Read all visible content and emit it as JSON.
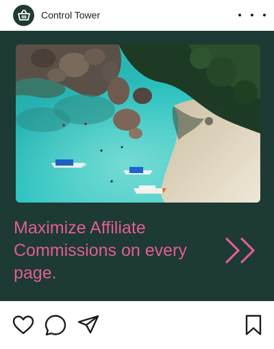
{
  "header": {
    "account_name": "Control Tower",
    "avatar_icon": "shopping-basket-icon",
    "more_icon": "more-horizontal-icon"
  },
  "post": {
    "image_alt": "Aerial view of turquoise water, boats and a sandy beach",
    "headline": "Maximize Affiliate Commissions on every page.",
    "cta_icon": "double-chevron-right-icon"
  },
  "actions": {
    "like_icon": "heart-icon",
    "comment_icon": "comment-icon",
    "share_icon": "send-icon",
    "save_icon": "bookmark-icon"
  },
  "colors": {
    "brand": "#1d3a34",
    "accent": "#e25e92",
    "icon": "#1b1b1b"
  }
}
